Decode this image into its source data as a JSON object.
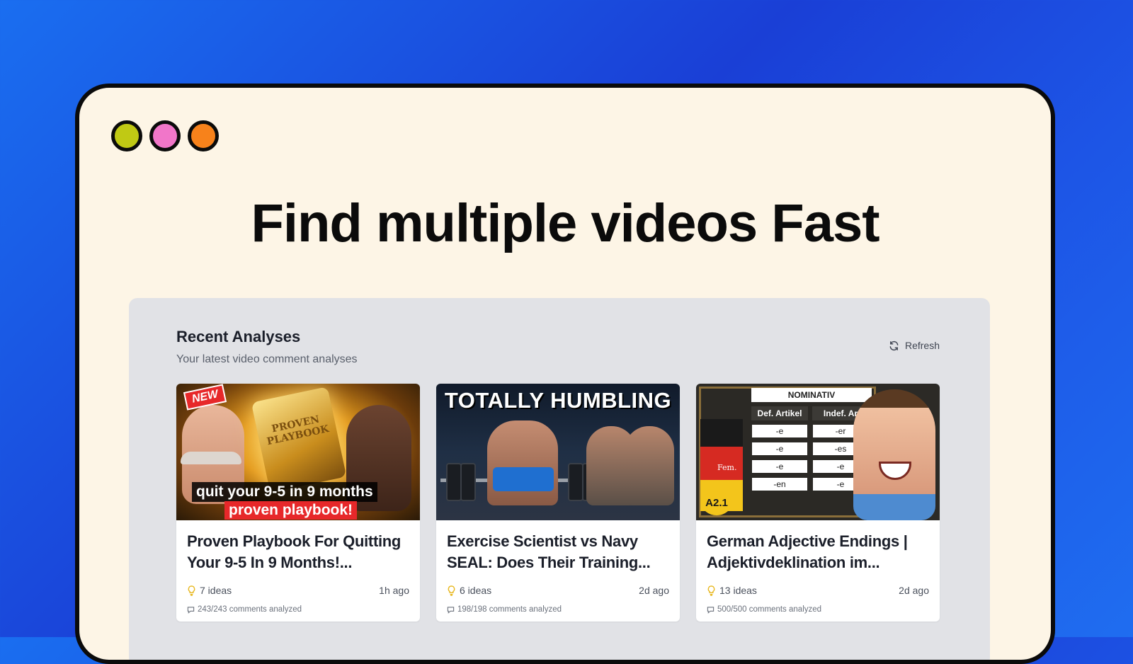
{
  "window": {
    "controls": [
      "close-dot",
      "minimize-dot",
      "maximize-dot"
    ]
  },
  "headline": "Find multiple videos Fast",
  "panel": {
    "title": "Recent Analyses",
    "subtitle": "Your latest video comment analyses",
    "refresh_label": "Refresh"
  },
  "cards": [
    {
      "title": "Proven Playbook For Quitting Your 9-5 In 9 Months!...",
      "ideas": "7 ideas",
      "ago": "1h ago",
      "comments": "243/243 comments analyzed",
      "thumb": {
        "badge": "NEW",
        "book_text": "PROVEN PLAYBOOK",
        "caption_line1": "quit your 9-5 in 9 months",
        "caption_line2": "proven playbook!"
      }
    },
    {
      "title": "Exercise Scientist vs Navy SEAL: Does Their Training...",
      "ideas": "6 ideas",
      "ago": "2d ago",
      "comments": "198/198 comments analyzed",
      "thumb": {
        "caption": "TOTALLY HUMBLING"
      }
    },
    {
      "title": "German Adjective Endings | Adjektivdeklination im...",
      "ideas": "13 ideas",
      "ago": "2d ago",
      "comments": "500/500 comments analyzed",
      "thumb": {
        "header": "NOMINATIV",
        "col1": "Def. Artikel",
        "col2": "Indef. Ar",
        "col1_cells": [
          "-e",
          "-e",
          "-e",
          "-en"
        ],
        "col2_cells": [
          "-er",
          "-es",
          "-e",
          "-e"
        ],
        "row_label": "Fem.",
        "level": "A2.1"
      }
    }
  ],
  "colors": {
    "background": "#1a3fd6",
    "window_bg": "#fdf5e6",
    "panel_bg": "#e1e2e6",
    "dot_close": "#c0c914",
    "dot_minimize": "#f176c9",
    "dot_maximize": "#f7821b",
    "idea_icon": "#e8b820"
  }
}
